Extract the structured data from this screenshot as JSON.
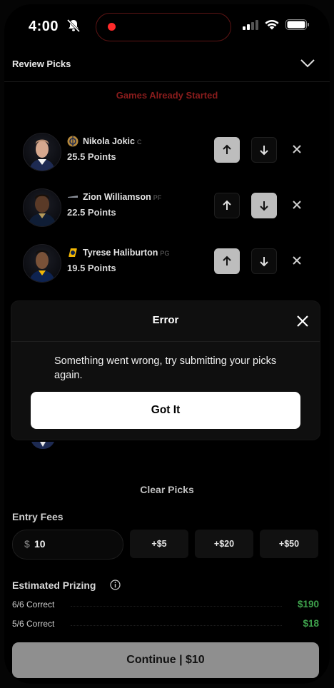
{
  "status_bar": {
    "time": "4:00"
  },
  "header": {
    "title": "Review Picks"
  },
  "notice": "Games Already Started",
  "players": [
    {
      "name": "Nikola Jokic",
      "position": "C",
      "line": "25.5 Points",
      "team_color": "#b7893b",
      "pick": "up"
    },
    {
      "name": "Zion Williamson",
      "position": "PF",
      "line": "22.5 Points",
      "team_color": "#2e3a4f",
      "pick": "down"
    },
    {
      "name": "Tyrese Haliburton",
      "position": "PG",
      "line": "19.5 Points",
      "team_color": "#f2b705",
      "pick": "up"
    }
  ],
  "modal": {
    "title": "Error",
    "message": "Something went wrong, try submitting your picks again.",
    "button": "Got It"
  },
  "clear_picks": "Clear Picks",
  "entry_fees": {
    "label": "Entry Fees",
    "currency": "$",
    "value": "10",
    "options": [
      "+$5",
      "+$20",
      "+$50"
    ]
  },
  "prizing": {
    "label": "Estimated Prizing",
    "rows": [
      {
        "label": "6/6 Correct",
        "amount": "$190"
      },
      {
        "label": "5/6 Correct",
        "amount": "$18"
      }
    ]
  },
  "continue_button": "Continue | $10"
}
